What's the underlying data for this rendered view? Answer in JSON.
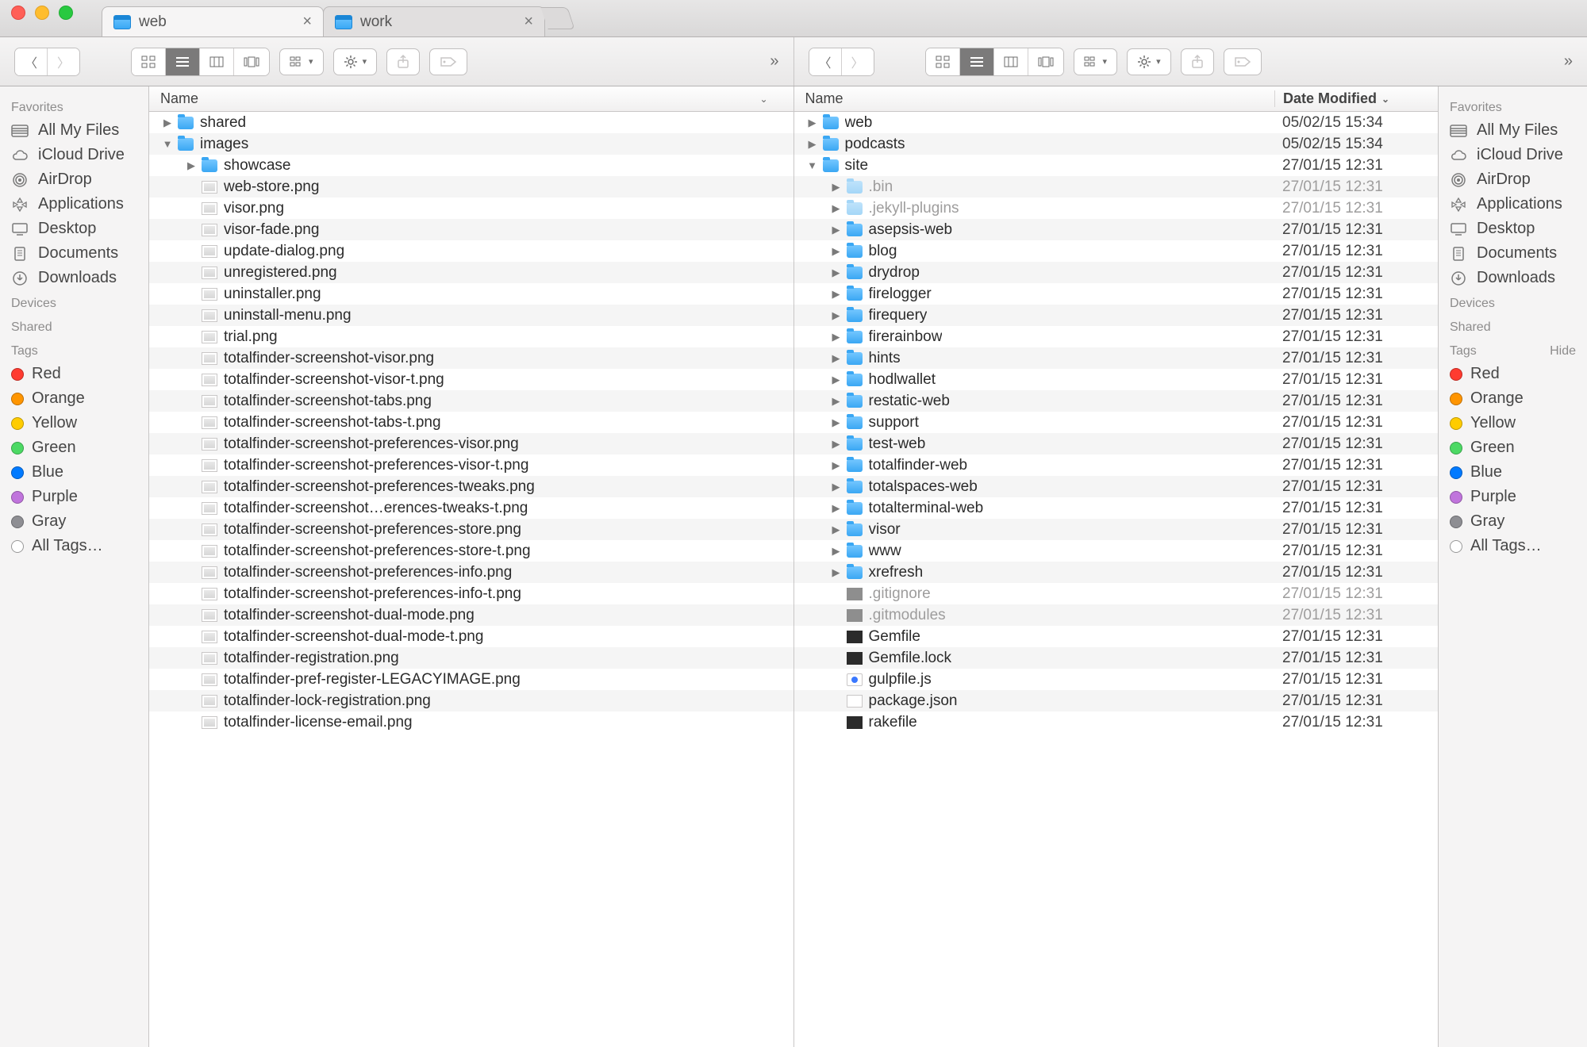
{
  "tabs": [
    {
      "title": "web",
      "active": true
    },
    {
      "title": "work",
      "active": false
    }
  ],
  "sidebar": {
    "favorites_heading": "Favorites",
    "devices_heading": "Devices",
    "shared_heading": "Shared",
    "tags_heading": "Tags",
    "tags_hide": "Hide",
    "favorites": [
      {
        "icon": "files",
        "label": "All My Files"
      },
      {
        "icon": "cloud",
        "label": "iCloud Drive"
      },
      {
        "icon": "airdrop",
        "label": "AirDrop"
      },
      {
        "icon": "apps",
        "label": "Applications"
      },
      {
        "icon": "desktop",
        "label": "Desktop"
      },
      {
        "icon": "docs",
        "label": "Documents"
      },
      {
        "icon": "download",
        "label": "Downloads"
      }
    ],
    "tags": [
      {
        "label": "Red",
        "color": "#ff3b30"
      },
      {
        "label": "Orange",
        "color": "#ff9500"
      },
      {
        "label": "Yellow",
        "color": "#ffcc00"
      },
      {
        "label": "Green",
        "color": "#4cd964"
      },
      {
        "label": "Blue",
        "color": "#007aff"
      },
      {
        "label": "Purple",
        "color": "#c074dc"
      },
      {
        "label": "Gray",
        "color": "#8e8e93"
      }
    ],
    "all_tags": "All Tags…"
  },
  "columns": {
    "name": "Name",
    "date": "Date Modified"
  },
  "left": [
    {
      "indent": 0,
      "disclosure": "right",
      "icon": "folder",
      "name": "shared"
    },
    {
      "indent": 0,
      "disclosure": "down",
      "icon": "folder",
      "name": "images"
    },
    {
      "indent": 1,
      "disclosure": "right",
      "icon": "folder",
      "name": "showcase"
    },
    {
      "indent": 1,
      "disclosure": "",
      "icon": "img",
      "name": "web-store.png"
    },
    {
      "indent": 1,
      "disclosure": "",
      "icon": "img",
      "name": "visor.png"
    },
    {
      "indent": 1,
      "disclosure": "",
      "icon": "img",
      "name": "visor-fade.png"
    },
    {
      "indent": 1,
      "disclosure": "",
      "icon": "img",
      "name": "update-dialog.png"
    },
    {
      "indent": 1,
      "disclosure": "",
      "icon": "img",
      "name": "unregistered.png"
    },
    {
      "indent": 1,
      "disclosure": "",
      "icon": "img",
      "name": "uninstaller.png"
    },
    {
      "indent": 1,
      "disclosure": "",
      "icon": "img",
      "name": "uninstall-menu.png"
    },
    {
      "indent": 1,
      "disclosure": "",
      "icon": "img",
      "name": "trial.png"
    },
    {
      "indent": 1,
      "disclosure": "",
      "icon": "img",
      "name": "totalfinder-screenshot-visor.png"
    },
    {
      "indent": 1,
      "disclosure": "",
      "icon": "img",
      "name": "totalfinder-screenshot-visor-t.png"
    },
    {
      "indent": 1,
      "disclosure": "",
      "icon": "img",
      "name": "totalfinder-screenshot-tabs.png"
    },
    {
      "indent": 1,
      "disclosure": "",
      "icon": "img",
      "name": "totalfinder-screenshot-tabs-t.png"
    },
    {
      "indent": 1,
      "disclosure": "",
      "icon": "img",
      "name": "totalfinder-screenshot-preferences-visor.png"
    },
    {
      "indent": 1,
      "disclosure": "",
      "icon": "img",
      "name": "totalfinder-screenshot-preferences-visor-t.png"
    },
    {
      "indent": 1,
      "disclosure": "",
      "icon": "img",
      "name": "totalfinder-screenshot-preferences-tweaks.png"
    },
    {
      "indent": 1,
      "disclosure": "",
      "icon": "img",
      "name": "totalfinder-screenshot…erences-tweaks-t.png"
    },
    {
      "indent": 1,
      "disclosure": "",
      "icon": "img",
      "name": "totalfinder-screenshot-preferences-store.png"
    },
    {
      "indent": 1,
      "disclosure": "",
      "icon": "img",
      "name": "totalfinder-screenshot-preferences-store-t.png"
    },
    {
      "indent": 1,
      "disclosure": "",
      "icon": "img",
      "name": "totalfinder-screenshot-preferences-info.png"
    },
    {
      "indent": 1,
      "disclosure": "",
      "icon": "img",
      "name": "totalfinder-screenshot-preferences-info-t.png"
    },
    {
      "indent": 1,
      "disclosure": "",
      "icon": "img",
      "name": "totalfinder-screenshot-dual-mode.png"
    },
    {
      "indent": 1,
      "disclosure": "",
      "icon": "img",
      "name": "totalfinder-screenshot-dual-mode-t.png"
    },
    {
      "indent": 1,
      "disclosure": "",
      "icon": "img",
      "name": "totalfinder-registration.png"
    },
    {
      "indent": 1,
      "disclosure": "",
      "icon": "img",
      "name": "totalfinder-pref-register-LEGACYIMAGE.png"
    },
    {
      "indent": 1,
      "disclosure": "",
      "icon": "img",
      "name": "totalfinder-lock-registration.png"
    },
    {
      "indent": 1,
      "disclosure": "",
      "icon": "img",
      "name": "totalfinder-license-email.png"
    }
  ],
  "right": [
    {
      "indent": 0,
      "disclosure": "right",
      "icon": "folder",
      "name": "web",
      "date": "05/02/15 15:34"
    },
    {
      "indent": 0,
      "disclosure": "right",
      "icon": "folder",
      "name": "podcasts",
      "date": "05/02/15 15:34"
    },
    {
      "indent": 0,
      "disclosure": "down",
      "icon": "folder",
      "name": "site",
      "date": "27/01/15 12:31"
    },
    {
      "indent": 1,
      "disclosure": "right",
      "icon": "folder_dim",
      "name": ".bin",
      "date": "27/01/15 12:31",
      "dim": true
    },
    {
      "indent": 1,
      "disclosure": "right",
      "icon": "folder_dim",
      "name": ".jekyll-plugins",
      "date": "27/01/15 12:31",
      "dim": true
    },
    {
      "indent": 1,
      "disclosure": "right",
      "icon": "folder",
      "name": "asepsis-web",
      "date": "27/01/15 12:31"
    },
    {
      "indent": 1,
      "disclosure": "right",
      "icon": "folder",
      "name": "blog",
      "date": "27/01/15 12:31"
    },
    {
      "indent": 1,
      "disclosure": "right",
      "icon": "folder",
      "name": "drydrop",
      "date": "27/01/15 12:31"
    },
    {
      "indent": 1,
      "disclosure": "right",
      "icon": "folder",
      "name": "firelogger",
      "date": "27/01/15 12:31"
    },
    {
      "indent": 1,
      "disclosure": "right",
      "icon": "folder",
      "name": "firequery",
      "date": "27/01/15 12:31"
    },
    {
      "indent": 1,
      "disclosure": "right",
      "icon": "folder",
      "name": "firerainbow",
      "date": "27/01/15 12:31"
    },
    {
      "indent": 1,
      "disclosure": "right",
      "icon": "folder",
      "name": "hints",
      "date": "27/01/15 12:31"
    },
    {
      "indent": 1,
      "disclosure": "right",
      "icon": "folder",
      "name": "hodlwallet",
      "date": "27/01/15 12:31"
    },
    {
      "indent": 1,
      "disclosure": "right",
      "icon": "folder",
      "name": "restatic-web",
      "date": "27/01/15 12:31"
    },
    {
      "indent": 1,
      "disclosure": "right",
      "icon": "folder",
      "name": "support",
      "date": "27/01/15 12:31"
    },
    {
      "indent": 1,
      "disclosure": "right",
      "icon": "folder",
      "name": "test-web",
      "date": "27/01/15 12:31"
    },
    {
      "indent": 1,
      "disclosure": "right",
      "icon": "folder",
      "name": "totalfinder-web",
      "date": "27/01/15 12:31"
    },
    {
      "indent": 1,
      "disclosure": "right",
      "icon": "folder",
      "name": "totalspaces-web",
      "date": "27/01/15 12:31"
    },
    {
      "indent": 1,
      "disclosure": "right",
      "icon": "folder",
      "name": "totalterminal-web",
      "date": "27/01/15 12:31"
    },
    {
      "indent": 1,
      "disclosure": "right",
      "icon": "folder",
      "name": "visor",
      "date": "27/01/15 12:31"
    },
    {
      "indent": 1,
      "disclosure": "right",
      "icon": "folder",
      "name": "www",
      "date": "27/01/15 12:31"
    },
    {
      "indent": 1,
      "disclosure": "right",
      "icon": "folder",
      "name": "xrefresh",
      "date": "27/01/15 12:31"
    },
    {
      "indent": 1,
      "disclosure": "",
      "icon": "gray",
      "name": ".gitignore",
      "date": "27/01/15 12:31",
      "dim": true
    },
    {
      "indent": 1,
      "disclosure": "",
      "icon": "gray",
      "name": ".gitmodules",
      "date": "27/01/15 12:31",
      "dim": true
    },
    {
      "indent": 1,
      "disclosure": "",
      "icon": "exec",
      "name": "Gemfile",
      "date": "27/01/15 12:31"
    },
    {
      "indent": 1,
      "disclosure": "",
      "icon": "exec",
      "name": "Gemfile.lock",
      "date": "27/01/15 12:31"
    },
    {
      "indent": 1,
      "disclosure": "",
      "icon": "js",
      "name": "gulpfile.js",
      "date": "27/01/15 12:31"
    },
    {
      "indent": 1,
      "disclosure": "",
      "icon": "file",
      "name": "package.json",
      "date": "27/01/15 12:31"
    },
    {
      "indent": 1,
      "disclosure": "",
      "icon": "exec",
      "name": "rakefile",
      "date": "27/01/15 12:31"
    }
  ]
}
